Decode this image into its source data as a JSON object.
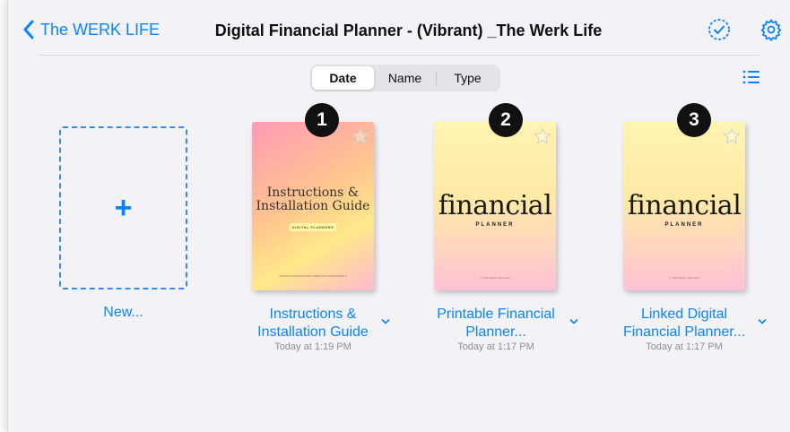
{
  "header": {
    "back_label": "The WERK LIFE",
    "title": "Digital Financial Planner - (Vibrant) _The Werk Life",
    "select_icon": "checkmark-circle-icon",
    "settings_icon": "gear-icon"
  },
  "sort": {
    "options": [
      "Date",
      "Name",
      "Type"
    ],
    "selected": "Date"
  },
  "view_icon": "list-view-icon",
  "new_item": {
    "label": "New...",
    "icon": "plus-icon"
  },
  "documents": [
    {
      "badge": "1",
      "cover_title": "Instructions & Installation Guide",
      "cover_tag": "DIGITAL PLANNERS",
      "cover_footer": "INSTALLATION FOR IPAD USERS ON GOODNOTES 5",
      "name_line1": "Instructions &",
      "name_line2": "Installation Guide",
      "date": "Today at 1:19 PM"
    },
    {
      "badge": "2",
      "cover_title": "financial",
      "cover_subtitle": "PLANNER",
      "cover_footer": "© THE WERK LIFE 2022",
      "name_line1": "Printable Financial",
      "name_line2": "Planner...",
      "date": "Today at 1:17 PM"
    },
    {
      "badge": "3",
      "cover_title": "financial",
      "cover_subtitle": "PLANNER",
      "cover_footer": "© THE WERK LIFE 2022",
      "name_line1": "Linked Digital",
      "name_line2": "Financial Planner...",
      "date": "Today at 1:17 PM"
    }
  ],
  "colors": {
    "accent": "#0a84ff",
    "background": "#f2f2f7",
    "badge": "#111111"
  }
}
